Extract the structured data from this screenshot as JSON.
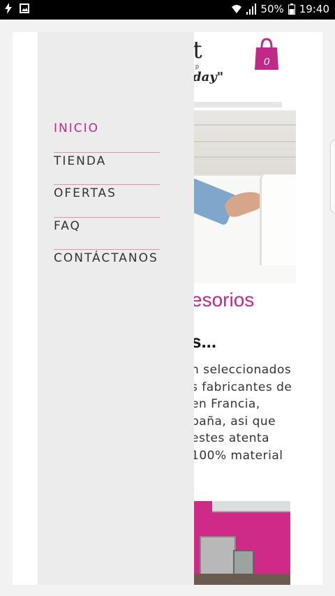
{
  "status_bar": {
    "battery": "50%",
    "time": "19:40",
    "icons": [
      "flash-icon",
      "image-icon",
      "wifi-icon",
      "signal-icon",
      "battery-icon"
    ]
  },
  "header": {
    "logo_fragment": "t",
    "logo_sub_fragment": "p",
    "tagline_fragment": "day\"",
    "cart_count": "0"
  },
  "content": {
    "heading_fragment": "esorios",
    "subheading_fragment": "s...",
    "paragraph_lines": [
      "n seleccionados",
      "s fabricantes de",
      "en      Francia,",
      "paña, asi que",
      "  estes  atenta",
      "100%   material"
    ]
  },
  "drawer": {
    "items": [
      {
        "label": "INICIO",
        "active": true
      },
      {
        "label": "TIENDA",
        "active": false
      },
      {
        "label": "OFERTAS",
        "active": false
      },
      {
        "label": "FAQ",
        "active": false
      },
      {
        "label": "CONTÁCTANOS",
        "active": false
      }
    ]
  },
  "colors": {
    "accent": "#c0298a",
    "drawer_bg": "#ececec",
    "divider": "#e08fba"
  }
}
